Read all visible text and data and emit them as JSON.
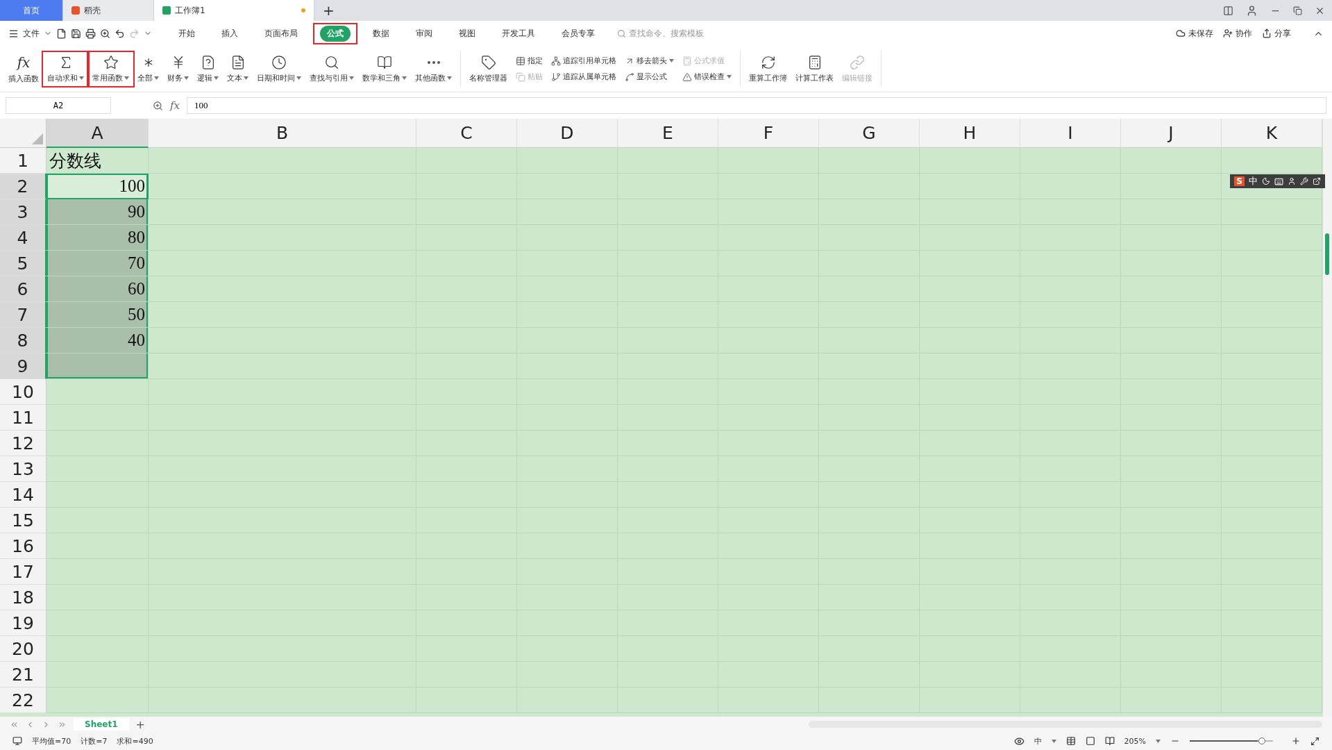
{
  "doc_tabs": [
    {
      "kind": "home",
      "label": "首页",
      "selected": false
    },
    {
      "kind": "app",
      "label": "稻壳",
      "selected": false
    },
    {
      "kind": "sheet",
      "label": "工作簿1",
      "selected": true,
      "modified": true
    }
  ],
  "new_tab": "+",
  "menu": {
    "file": "文件",
    "tabs": [
      {
        "label": "开始",
        "selected": false
      },
      {
        "label": "插入",
        "selected": false
      },
      {
        "label": "页面布局",
        "selected": false
      },
      {
        "label": "公式",
        "selected": true,
        "highlighted": true
      },
      {
        "label": "数据",
        "selected": false
      },
      {
        "label": "审阅",
        "selected": false
      },
      {
        "label": "视图",
        "selected": false
      },
      {
        "label": "开发工具",
        "selected": false
      },
      {
        "label": "会员专享",
        "selected": false
      }
    ],
    "search_placeholder": "查找命令、搜索模板",
    "right": [
      {
        "kind": "cloud",
        "label": "未保存"
      },
      {
        "kind": "user",
        "label": "协作"
      },
      {
        "kind": "share",
        "label": "分享"
      }
    ]
  },
  "ribbon": {
    "big": [
      {
        "kind": "fx",
        "glyph": "fx",
        "label": "插入函数",
        "dropdown": false,
        "highlighted": false
      },
      {
        "kind": "sigma",
        "label": "自动求和",
        "dropdown": true,
        "highlighted": true
      },
      {
        "kind": "star",
        "label": "常用函数",
        "dropdown": true,
        "highlighted": true
      },
      {
        "kind": "all",
        "label": "全部",
        "dropdown": true,
        "highlighted": false
      },
      {
        "kind": "yen",
        "label": "财务",
        "dropdown": true,
        "highlighted": false
      },
      {
        "kind": "logic",
        "label": "逻辑",
        "dropdown": true,
        "highlighted": false
      },
      {
        "kind": "text",
        "label": "文本",
        "dropdown": true,
        "highlighted": false
      },
      {
        "kind": "clock",
        "label": "日期和时间",
        "dropdown": true,
        "highlighted": false
      },
      {
        "kind": "search",
        "label": "查找与引用",
        "dropdown": true,
        "highlighted": false
      },
      {
        "kind": "math",
        "label": "数学和三角",
        "dropdown": true,
        "highlighted": false
      },
      {
        "kind": "more",
        "label": "其他函数",
        "dropdown": true,
        "highlighted": false
      },
      {
        "kind": "names",
        "label": "名称管理器",
        "dropdown": false,
        "highlighted": false
      }
    ],
    "small": [
      [
        {
          "label": "指定",
          "disabled": false,
          "dropdown": false
        },
        {
          "label": "粘贴",
          "disabled": true,
          "dropdown": false
        }
      ],
      [
        {
          "label": "追踪引用单元格",
          "disabled": false,
          "dropdown": false
        },
        {
          "label": "追踪从属单元格",
          "disabled": false,
          "dropdown": false
        }
      ],
      [
        {
          "label": "移去箭头",
          "disabled": false,
          "dropdown": true
        },
        {
          "label": "显示公式",
          "disabled": false,
          "dropdown": false
        }
      ],
      [
        {
          "label": "公式求值",
          "disabled": true,
          "dropdown": false
        },
        {
          "label": "错误检查",
          "disabled": false,
          "dropdown": true
        }
      ]
    ],
    "calc": [
      {
        "kind": "recalc",
        "label": "重算工作簿",
        "disabled": false
      },
      {
        "kind": "sheet",
        "label": "计算工作表",
        "disabled": false
      },
      {
        "kind": "link",
        "label": "编辑链接",
        "disabled": true
      }
    ]
  },
  "name_box": "A2",
  "formula_glyph": "fx",
  "formula": "100",
  "columns": [
    {
      "label": "A",
      "selected": true
    },
    {
      "label": "B",
      "selected": false
    },
    {
      "label": "C",
      "selected": false
    },
    {
      "label": "D",
      "selected": false
    },
    {
      "label": "E",
      "selected": false
    },
    {
      "label": "F",
      "selected": false
    },
    {
      "label": "G",
      "selected": false
    },
    {
      "label": "H",
      "selected": false
    },
    {
      "label": "I",
      "selected": false
    },
    {
      "label": "J",
      "selected": false
    },
    {
      "label": "K",
      "selected": false
    }
  ],
  "rows": [
    {
      "label": "1",
      "value": "分数线",
      "kind": "text",
      "selected": false,
      "active": false
    },
    {
      "label": "2",
      "value": "100",
      "kind": "number",
      "selected": true,
      "active": true
    },
    {
      "label": "3",
      "value": "90",
      "kind": "number",
      "selected": true,
      "active": false
    },
    {
      "label": "4",
      "value": "80",
      "kind": "number",
      "selected": true,
      "active": false
    },
    {
      "label": "5",
      "value": "70",
      "kind": "number",
      "selected": true,
      "active": false
    },
    {
      "label": "6",
      "value": "60",
      "kind": "number",
      "selected": true,
      "active": false
    },
    {
      "label": "7",
      "value": "50",
      "kind": "number",
      "selected": true,
      "active": false
    },
    {
      "label": "8",
      "value": "40",
      "kind": "number",
      "selected": true,
      "active": false
    },
    {
      "label": "9",
      "selected": true,
      "active": false
    },
    {
      "label": "10",
      "selected": false,
      "active": false
    },
    {
      "label": "11",
      "selected": false,
      "active": false
    },
    {
      "label": "12",
      "selected": false,
      "active": false
    },
    {
      "label": "13",
      "selected": false,
      "active": false
    },
    {
      "label": "14",
      "selected": false,
      "active": false
    },
    {
      "label": "15",
      "selected": false,
      "active": false
    },
    {
      "label": "16",
      "selected": false,
      "active": false
    },
    {
      "label": "17",
      "selected": false,
      "active": false
    },
    {
      "label": "18",
      "selected": false,
      "active": false
    },
    {
      "label": "19",
      "selected": false,
      "active": false
    },
    {
      "label": "20",
      "selected": false,
      "active": false
    },
    {
      "label": "21",
      "selected": false,
      "active": false
    },
    {
      "label": "22",
      "selected": false,
      "active": false
    }
  ],
  "ime": {
    "logo": "S",
    "mode": "中"
  },
  "sheets": [
    {
      "label": "Sheet1",
      "selected": true
    }
  ],
  "add_sheet": "+",
  "status": [
    "平均值=70",
    "计数=7",
    "求和=490"
  ],
  "view_mode": "中",
  "zoom": {
    "label": "205%",
    "level": 0.82
  }
}
